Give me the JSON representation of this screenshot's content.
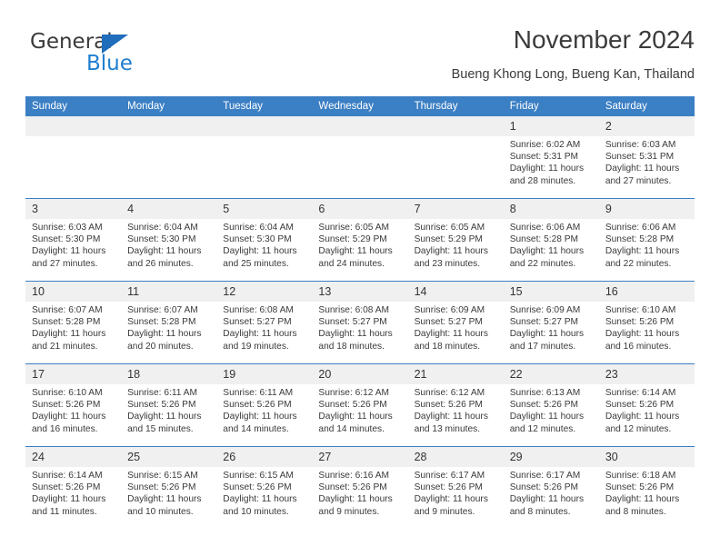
{
  "brand": {
    "name_top": "General",
    "name_bottom": "Blue",
    "color_dark": "#3a3a3a",
    "color_blue": "#1f7fd0",
    "triangle_color": "#1f6dbb"
  },
  "header": {
    "title": "November 2024",
    "subtitle": "Bueng Khong Long, Bueng Kan, Thailand"
  },
  "theme": {
    "header_row_bg": "#3b7fc4",
    "header_row_text": "#ffffff",
    "daynum_bg": "#f0f0f0",
    "cell_border": "#3b7fc4",
    "body_text": "#3a3a3a"
  },
  "weekdays": [
    "Sunday",
    "Monday",
    "Tuesday",
    "Wednesday",
    "Thursday",
    "Friday",
    "Saturday"
  ],
  "weeks": [
    [
      {
        "day": "",
        "sunrise": "",
        "sunset": "",
        "daylight_line1": "",
        "daylight_line2": "",
        "blank": true
      },
      {
        "day": "",
        "sunrise": "",
        "sunset": "",
        "daylight_line1": "",
        "daylight_line2": "",
        "blank": true
      },
      {
        "day": "",
        "sunrise": "",
        "sunset": "",
        "daylight_line1": "",
        "daylight_line2": "",
        "blank": true
      },
      {
        "day": "",
        "sunrise": "",
        "sunset": "",
        "daylight_line1": "",
        "daylight_line2": "",
        "blank": true
      },
      {
        "day": "",
        "sunrise": "",
        "sunset": "",
        "daylight_line1": "",
        "daylight_line2": "",
        "blank": true
      },
      {
        "day": "1",
        "sunrise": "Sunrise: 6:02 AM",
        "sunset": "Sunset: 5:31 PM",
        "daylight_line1": "Daylight: 11 hours",
        "daylight_line2": "and 28 minutes."
      },
      {
        "day": "2",
        "sunrise": "Sunrise: 6:03 AM",
        "sunset": "Sunset: 5:31 PM",
        "daylight_line1": "Daylight: 11 hours",
        "daylight_line2": "and 27 minutes."
      }
    ],
    [
      {
        "day": "3",
        "sunrise": "Sunrise: 6:03 AM",
        "sunset": "Sunset: 5:30 PM",
        "daylight_line1": "Daylight: 11 hours",
        "daylight_line2": "and 27 minutes."
      },
      {
        "day": "4",
        "sunrise": "Sunrise: 6:04 AM",
        "sunset": "Sunset: 5:30 PM",
        "daylight_line1": "Daylight: 11 hours",
        "daylight_line2": "and 26 minutes."
      },
      {
        "day": "5",
        "sunrise": "Sunrise: 6:04 AM",
        "sunset": "Sunset: 5:30 PM",
        "daylight_line1": "Daylight: 11 hours",
        "daylight_line2": "and 25 minutes."
      },
      {
        "day": "6",
        "sunrise": "Sunrise: 6:05 AM",
        "sunset": "Sunset: 5:29 PM",
        "daylight_line1": "Daylight: 11 hours",
        "daylight_line2": "and 24 minutes."
      },
      {
        "day": "7",
        "sunrise": "Sunrise: 6:05 AM",
        "sunset": "Sunset: 5:29 PM",
        "daylight_line1": "Daylight: 11 hours",
        "daylight_line2": "and 23 minutes."
      },
      {
        "day": "8",
        "sunrise": "Sunrise: 6:06 AM",
        "sunset": "Sunset: 5:28 PM",
        "daylight_line1": "Daylight: 11 hours",
        "daylight_line2": "and 22 minutes."
      },
      {
        "day": "9",
        "sunrise": "Sunrise: 6:06 AM",
        "sunset": "Sunset: 5:28 PM",
        "daylight_line1": "Daylight: 11 hours",
        "daylight_line2": "and 22 minutes."
      }
    ],
    [
      {
        "day": "10",
        "sunrise": "Sunrise: 6:07 AM",
        "sunset": "Sunset: 5:28 PM",
        "daylight_line1": "Daylight: 11 hours",
        "daylight_line2": "and 21 minutes."
      },
      {
        "day": "11",
        "sunrise": "Sunrise: 6:07 AM",
        "sunset": "Sunset: 5:28 PM",
        "daylight_line1": "Daylight: 11 hours",
        "daylight_line2": "and 20 minutes."
      },
      {
        "day": "12",
        "sunrise": "Sunrise: 6:08 AM",
        "sunset": "Sunset: 5:27 PM",
        "daylight_line1": "Daylight: 11 hours",
        "daylight_line2": "and 19 minutes."
      },
      {
        "day": "13",
        "sunrise": "Sunrise: 6:08 AM",
        "sunset": "Sunset: 5:27 PM",
        "daylight_line1": "Daylight: 11 hours",
        "daylight_line2": "and 18 minutes."
      },
      {
        "day": "14",
        "sunrise": "Sunrise: 6:09 AM",
        "sunset": "Sunset: 5:27 PM",
        "daylight_line1": "Daylight: 11 hours",
        "daylight_line2": "and 18 minutes."
      },
      {
        "day": "15",
        "sunrise": "Sunrise: 6:09 AM",
        "sunset": "Sunset: 5:27 PM",
        "daylight_line1": "Daylight: 11 hours",
        "daylight_line2": "and 17 minutes."
      },
      {
        "day": "16",
        "sunrise": "Sunrise: 6:10 AM",
        "sunset": "Sunset: 5:26 PM",
        "daylight_line1": "Daylight: 11 hours",
        "daylight_line2": "and 16 minutes."
      }
    ],
    [
      {
        "day": "17",
        "sunrise": "Sunrise: 6:10 AM",
        "sunset": "Sunset: 5:26 PM",
        "daylight_line1": "Daylight: 11 hours",
        "daylight_line2": "and 16 minutes."
      },
      {
        "day": "18",
        "sunrise": "Sunrise: 6:11 AM",
        "sunset": "Sunset: 5:26 PM",
        "daylight_line1": "Daylight: 11 hours",
        "daylight_line2": "and 15 minutes."
      },
      {
        "day": "19",
        "sunrise": "Sunrise: 6:11 AM",
        "sunset": "Sunset: 5:26 PM",
        "daylight_line1": "Daylight: 11 hours",
        "daylight_line2": "and 14 minutes."
      },
      {
        "day": "20",
        "sunrise": "Sunrise: 6:12 AM",
        "sunset": "Sunset: 5:26 PM",
        "daylight_line1": "Daylight: 11 hours",
        "daylight_line2": "and 14 minutes."
      },
      {
        "day": "21",
        "sunrise": "Sunrise: 6:12 AM",
        "sunset": "Sunset: 5:26 PM",
        "daylight_line1": "Daylight: 11 hours",
        "daylight_line2": "and 13 minutes."
      },
      {
        "day": "22",
        "sunrise": "Sunrise: 6:13 AM",
        "sunset": "Sunset: 5:26 PM",
        "daylight_line1": "Daylight: 11 hours",
        "daylight_line2": "and 12 minutes."
      },
      {
        "day": "23",
        "sunrise": "Sunrise: 6:14 AM",
        "sunset": "Sunset: 5:26 PM",
        "daylight_line1": "Daylight: 11 hours",
        "daylight_line2": "and 12 minutes."
      }
    ],
    [
      {
        "day": "24",
        "sunrise": "Sunrise: 6:14 AM",
        "sunset": "Sunset: 5:26 PM",
        "daylight_line1": "Daylight: 11 hours",
        "daylight_line2": "and 11 minutes."
      },
      {
        "day": "25",
        "sunrise": "Sunrise: 6:15 AM",
        "sunset": "Sunset: 5:26 PM",
        "daylight_line1": "Daylight: 11 hours",
        "daylight_line2": "and 10 minutes."
      },
      {
        "day": "26",
        "sunrise": "Sunrise: 6:15 AM",
        "sunset": "Sunset: 5:26 PM",
        "daylight_line1": "Daylight: 11 hours",
        "daylight_line2": "and 10 minutes."
      },
      {
        "day": "27",
        "sunrise": "Sunrise: 6:16 AM",
        "sunset": "Sunset: 5:26 PM",
        "daylight_line1": "Daylight: 11 hours",
        "daylight_line2": "and 9 minutes."
      },
      {
        "day": "28",
        "sunrise": "Sunrise: 6:17 AM",
        "sunset": "Sunset: 5:26 PM",
        "daylight_line1": "Daylight: 11 hours",
        "daylight_line2": "and 9 minutes."
      },
      {
        "day": "29",
        "sunrise": "Sunrise: 6:17 AM",
        "sunset": "Sunset: 5:26 PM",
        "daylight_line1": "Daylight: 11 hours",
        "daylight_line2": "and 8 minutes."
      },
      {
        "day": "30",
        "sunrise": "Sunrise: 6:18 AM",
        "sunset": "Sunset: 5:26 PM",
        "daylight_line1": "Daylight: 11 hours",
        "daylight_line2": "and 8 minutes."
      }
    ]
  ]
}
